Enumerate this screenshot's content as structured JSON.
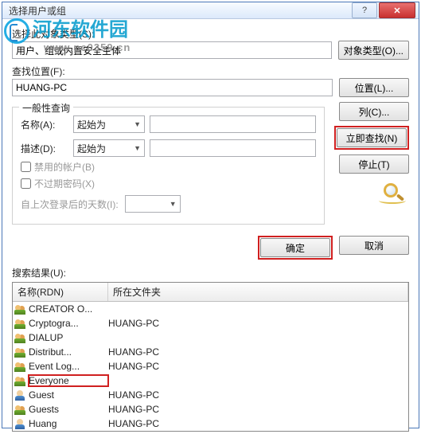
{
  "watermark": {
    "brand": "河东软件园",
    "url": "www.pc0359.cn"
  },
  "titlebar": {
    "title": "选择用户或组",
    "help": "?",
    "close": "✕"
  },
  "objtype": {
    "label": "选择此对象类型(S):",
    "value": "用户、组或内置安全主体",
    "btn": "对象类型(O)..."
  },
  "location": {
    "label": "查找位置(F):",
    "value": "HUANG-PC",
    "btn": "位置(L)..."
  },
  "query": {
    "legend": "一般性查询",
    "name_lbl": "名称(A):",
    "name_op": "起始为",
    "desc_lbl": "描述(D):",
    "desc_op": "起始为",
    "chk_disabled": "禁用的帐户(B)",
    "chk_noexpire": "不过期密码(X)",
    "lastlogon_lbl": "自上次登录后的天数(I):"
  },
  "sidebuttons": {
    "columns": "列(C)...",
    "findnow": "立即查找(N)",
    "stop": "停止(T)"
  },
  "actions": {
    "ok": "确定",
    "cancel": "取消"
  },
  "results": {
    "label": "搜索结果(U):",
    "col1": "名称(RDN)",
    "col2": "所在文件夹",
    "rows": [
      {
        "icon": "grp",
        "name": "CREATOR O...",
        "folder": ""
      },
      {
        "icon": "grp",
        "name": "Cryptogra...",
        "folder": "HUANG-PC"
      },
      {
        "icon": "grp",
        "name": "DIALUP",
        "folder": ""
      },
      {
        "icon": "grp",
        "name": "Distribut...",
        "folder": "HUANG-PC"
      },
      {
        "icon": "grp",
        "name": "Event Log...",
        "folder": "HUANG-PC"
      },
      {
        "icon": "grp",
        "name": "Everyone",
        "folder": "",
        "hl": true
      },
      {
        "icon": "usr",
        "name": "Guest",
        "folder": "HUANG-PC"
      },
      {
        "icon": "grp",
        "name": "Guests",
        "folder": "HUANG-PC"
      },
      {
        "icon": "usr",
        "name": "Huang",
        "folder": "HUANG-PC"
      }
    ]
  }
}
